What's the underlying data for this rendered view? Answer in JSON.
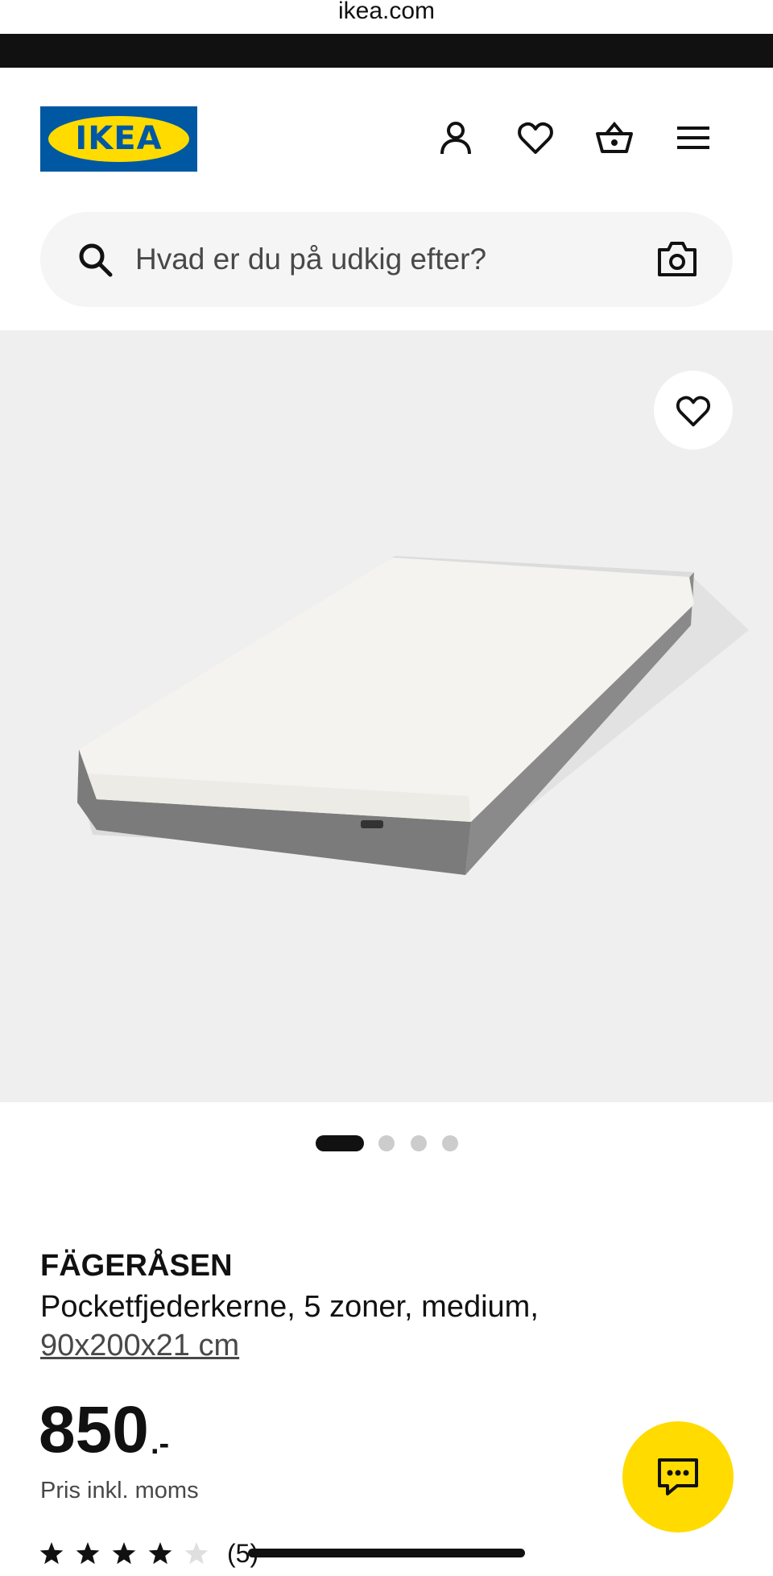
{
  "browser": {
    "url": "ikea.com"
  },
  "header": {
    "logo_text": "IKEA",
    "icons": [
      "profile-icon",
      "heart-icon",
      "basket-icon",
      "menu-icon"
    ]
  },
  "search": {
    "placeholder": "Hvad er du på udkig efter?",
    "camera_icon": "camera-icon"
  },
  "gallery": {
    "image_count": 4,
    "active_index": 0,
    "favorite_icon": "heart-icon"
  },
  "product": {
    "name": "FÄGERÅSEN",
    "description": "Pocketfjederkerne, 5 zoner, medium,",
    "size": "90x200x21 cm",
    "price": "850",
    "price_suffix": ".-",
    "price_note": "Pris inkl. moms",
    "rating": 4,
    "rating_max": 5,
    "review_count": "(5)"
  },
  "chat": {
    "icon": "chat-icon"
  },
  "colors": {
    "brand_blue": "#0058a3",
    "brand_yellow": "#ffdb00",
    "text": "#111111",
    "muted": "#484848"
  }
}
